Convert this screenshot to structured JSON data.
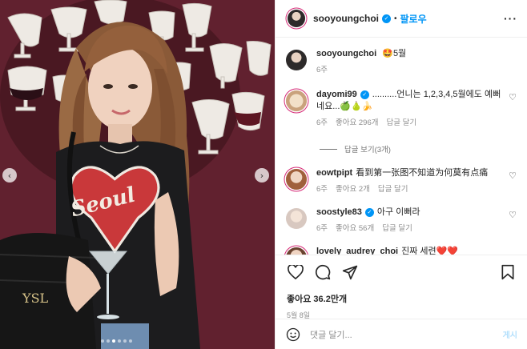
{
  "photo": {
    "shirt_text": "Seoul",
    "carousel_count": 6,
    "carousel_active": 2
  },
  "header": {
    "username": "sooyoungchoi",
    "separator": "•",
    "follow_label": "팔로우",
    "more_label": "···"
  },
  "caption": {
    "username": "sooyoungchoi",
    "emoji": "🤩",
    "text": "5월",
    "time": "6주"
  },
  "comments": [
    {
      "username": "dayomi99",
      "verified": true,
      "text": "..........언니는 1,2,3,4,5월에도 예뻐네요...🍏🍐🍌",
      "time": "6주",
      "likes": "좋아요 296개",
      "reply": "답글 달기",
      "view_replies": "답글 보기(3개)"
    },
    {
      "username": "eowtpipt",
      "verified": false,
      "text": "看到第一张图不知道为何莫有点痛",
      "time": "6주",
      "likes": "좋아요 2개",
      "reply": "답글 달기"
    },
    {
      "username": "soostyle83",
      "verified": true,
      "text": "아구 이뻐라",
      "time": "6주",
      "likes": "좋아요 56개",
      "reply": "답글 달기"
    },
    {
      "username": "lovely_audrey_choi",
      "verified": false,
      "text": "진짜 세련❤️❤️",
      "time": "",
      "likes": "",
      "reply": ""
    }
  ],
  "actions": {
    "likes_text": "좋아요 36.2만개",
    "date": "5월 8일"
  },
  "add_comment": {
    "placeholder": "댓글 달기...",
    "post_label": "게시"
  },
  "colors": {
    "accent": "#0095f6",
    "wall": "#5a1f2c",
    "shirt": "#1c1c1e",
    "heart": "#c9383a"
  }
}
